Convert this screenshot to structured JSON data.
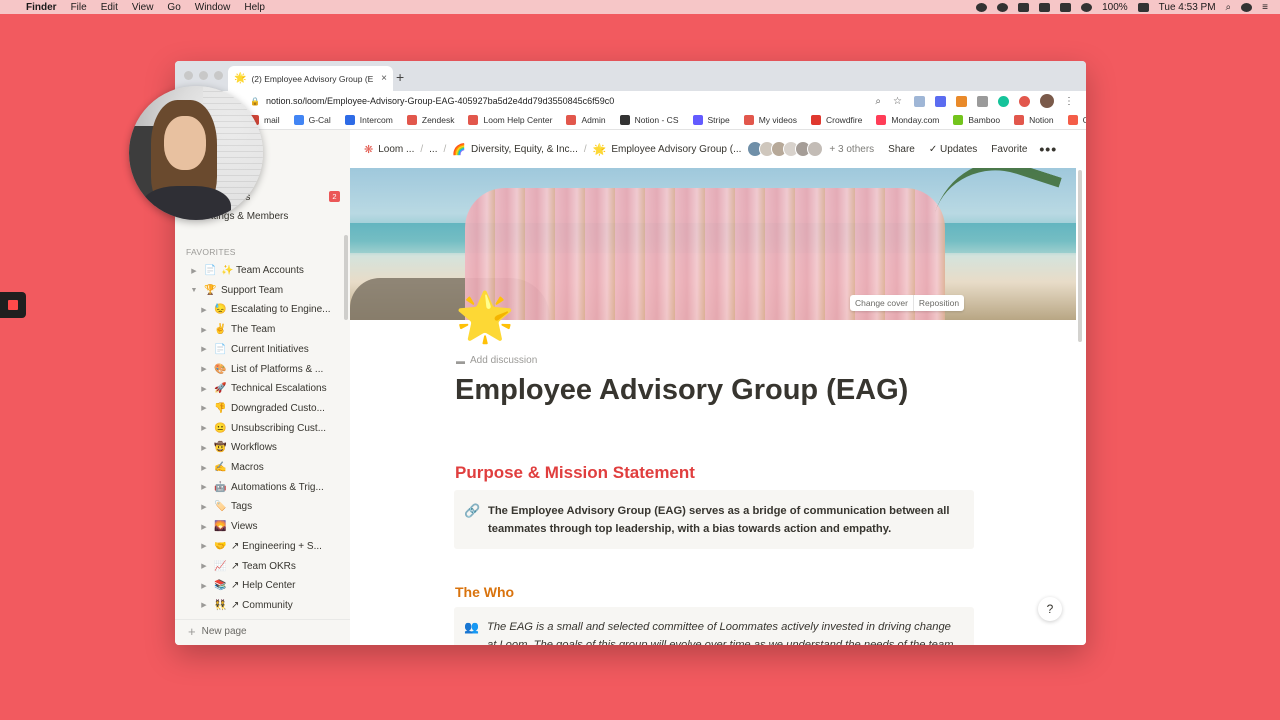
{
  "menubar": {
    "apple": "",
    "items": [
      "Finder",
      "File",
      "Edit",
      "View",
      "Go",
      "Window",
      "Help"
    ],
    "battery": "100%",
    "clock": "Tue 4:53 PM"
  },
  "browser": {
    "tab_title": "(2) Employee Advisory Group (E",
    "tab_close": "×",
    "new_tab": "+",
    "url": "notion.so/loom/Employee-Advisory-Group-EAG-405927ba5d2e4dd79d3550845c6f59c0",
    "bookmarks": [
      {
        "label": "mail",
        "color": "#d44638"
      },
      {
        "label": "G-Cal",
        "color": "#4285f4"
      },
      {
        "label": "Intercom",
        "color": "#2e6be6"
      },
      {
        "label": "Zendesk",
        "color": "#e2574c"
      },
      {
        "label": "Loom Help Center",
        "color": "#e2574c"
      },
      {
        "label": "Admin",
        "color": "#e2574c"
      },
      {
        "label": "Notion - CS",
        "color": "#333333"
      },
      {
        "label": "Stripe",
        "color": "#635bff"
      },
      {
        "label": "My videos",
        "color": "#e2574c"
      },
      {
        "label": "Crowdfire",
        "color": "#e0382f"
      },
      {
        "label": "Monday.com",
        "color": "#ff3d57"
      },
      {
        "label": "Bamboo",
        "color": "#73c41d"
      },
      {
        "label": "Notion",
        "color": "#e2574c"
      },
      {
        "label": "Gusto",
        "color": "#f45d48"
      }
    ],
    "bookmarks_more": "»"
  },
  "sidebar": {
    "updates_label": "tes",
    "updates_badge": "2",
    "settings_label": "ettings & Members",
    "favorites_label": "FAVORITES",
    "items": [
      {
        "caret": "▶",
        "emoji": "📄",
        "label": "✨ Team Accounts"
      },
      {
        "caret": "▼",
        "emoji": "🏆",
        "label": "Support Team"
      },
      {
        "caret": "▶",
        "emoji": "😓",
        "label": "Escalating to Engine..."
      },
      {
        "caret": "▶",
        "emoji": "✌️",
        "label": "The Team"
      },
      {
        "caret": "▶",
        "emoji": "📄",
        "label": "Current Initiatives"
      },
      {
        "caret": "▶",
        "emoji": "🎨",
        "label": "List of Platforms & ..."
      },
      {
        "caret": "▶",
        "emoji": "🚀",
        "label": "Technical Escalations"
      },
      {
        "caret": "▶",
        "emoji": "👎",
        "label": "Downgraded Custo..."
      },
      {
        "caret": "▶",
        "emoji": "😐",
        "label": "Unsubscribing Cust..."
      },
      {
        "caret": "▶",
        "emoji": "🤠",
        "label": "Workflows"
      },
      {
        "caret": "▶",
        "emoji": "✍️",
        "label": "Macros"
      },
      {
        "caret": "▶",
        "emoji": "🤖",
        "label": "Automations & Trig..."
      },
      {
        "caret": "▶",
        "emoji": "🏷️",
        "label": "Tags"
      },
      {
        "caret": "▶",
        "emoji": "🌄",
        "label": "Views"
      },
      {
        "caret": "▶",
        "emoji": "🤝",
        "label": "↗ Engineering + S..."
      },
      {
        "caret": "▶",
        "emoji": "📈",
        "label": "↗ Team OKRs"
      },
      {
        "caret": "▶",
        "emoji": "📚",
        "label": "↗ Help Center"
      },
      {
        "caret": "▶",
        "emoji": "👯",
        "label": "↗ Community"
      }
    ],
    "new_page": "New page"
  },
  "topbar": {
    "crumbs": [
      {
        "emoji": "",
        "label": "Loom ..."
      },
      {
        "emoji": "",
        "label": "..."
      },
      {
        "emoji": "🌈",
        "label": "Diversity, Equity, & Inc..."
      },
      {
        "emoji": "🌟",
        "label": "Employee Advisory Group (..."
      }
    ],
    "others": "+ 3 others",
    "share": "Share",
    "updates": "Updates",
    "favorite": "Favorite",
    "more": "•••"
  },
  "page": {
    "cover_change": "Change cover",
    "cover_reposition": "Reposition",
    "icon": "🌟",
    "add_discussion": "Add discussion",
    "title": "Employee Advisory Group (EAG)",
    "purpose_heading": "Purpose & Mission Statement",
    "purpose_icon": "🔗",
    "purpose_text": "The Employee Advisory Group (EAG) serves as a bridge of communication between all teammates through top leadership, with a bias towards action and empathy.",
    "who_heading": "The Who",
    "who_icon": "👥",
    "who_text": "The EAG is a small and selected committee of Loommates actively invested in driving change at Loom. The goals of this group will evolve over time as we understand the needs of the team",
    "help": "?"
  },
  "colors": {
    "background": "#f25a5f",
    "purpose_heading": "#e03e3e",
    "who_heading": "#d9730d"
  }
}
